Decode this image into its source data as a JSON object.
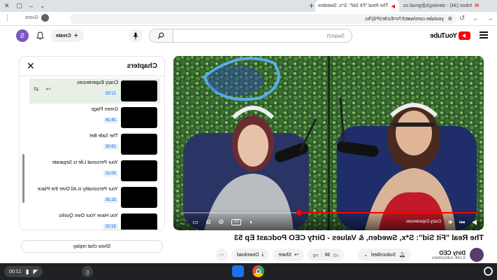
{
  "browser": {
    "tabs": [
      {
        "title": "Inbox (34) - steviixg3@gmail.co",
        "favicon": "M",
        "active": false
      },
      {
        "title": "The Real \"Fit Sid\": S*x, Swedem",
        "favicon": "▶",
        "active": true
      }
    ],
    "address": "youtube.com/watch?v=Ez3e1P0j7kc",
    "profile_label": "Guest"
  },
  "youtube": {
    "logo_text": "YouTube",
    "search_placeholder": "Search",
    "create_label": "Create",
    "avatar_letter": "S"
  },
  "player": {
    "chapter_label": "Crazy Experiences",
    "progress_fraction": 0.6,
    "hd_badge": "HD"
  },
  "video": {
    "title": "The Real \"Fit Sid\": S*x, Sweden, & Values - Dirty CEO Podcast Ep 53",
    "channel_name": "Dirty CEO",
    "subscribers": "3.16K subscribers",
    "subscribed_label": "Subscribed",
    "like_count": "38",
    "share_label": "Share",
    "download_label": "Download"
  },
  "chapters": {
    "title": "Chapters",
    "items": [
      {
        "name": "Crazy Experiences",
        "time": "22:53",
        "current": true
      },
      {
        "name": "Green Flags",
        "time": "26:16",
        "current": false
      },
      {
        "name": "The Safe Bet",
        "time": "29:05",
        "current": false
      },
      {
        "name": "Your Personal Life is Separate",
        "time": "30:12",
        "current": false
      },
      {
        "name": "Your Personality is All Over the Place",
        "time": "31:35",
        "current": false
      },
      {
        "name": "You Have Your Own Quirks",
        "time": "32:02",
        "current": false
      }
    ]
  },
  "chat": {
    "show_replay_label": "Show chat replay"
  },
  "shelf": {
    "time": "12:00"
  },
  "colors": {
    "accent_red": "#ff0000",
    "chapter_time_bg": "#def1ff",
    "chapter_time_fg": "#065fd4",
    "shelf_bg": "#202124"
  }
}
